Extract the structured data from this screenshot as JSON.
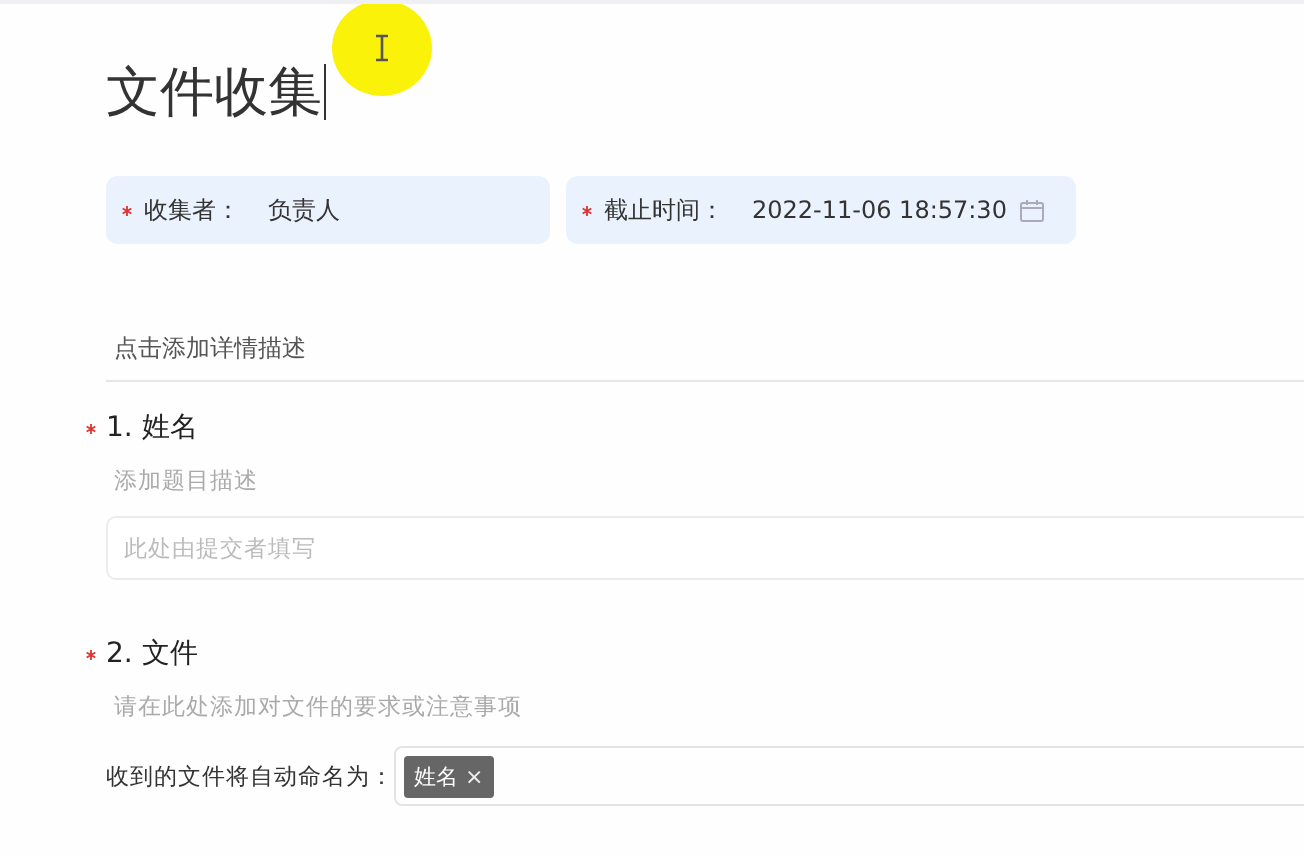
{
  "title": "文件收集",
  "fields": [
    {
      "label": "收集者：",
      "value": "负责人",
      "required": true,
      "kind": "text"
    },
    {
      "label": "截止时间：",
      "value": "2022-11-06 18:57:30",
      "required": true,
      "kind": "date"
    }
  ],
  "description_placeholder": "点击添加详情描述",
  "questions": [
    {
      "number": "1.",
      "title": "姓名",
      "required": true,
      "description_placeholder": "添加题目描述",
      "kind": "text",
      "input_placeholder": "此处由提交者填写"
    },
    {
      "number": "2.",
      "title": "文件",
      "required": true,
      "description_placeholder": "请在此处添加对文件的要求或注意事项",
      "kind": "file",
      "naming_label": "收到的文件将自动命名为：",
      "tags": [
        "姓名"
      ],
      "tag_remove": "×"
    }
  ]
}
